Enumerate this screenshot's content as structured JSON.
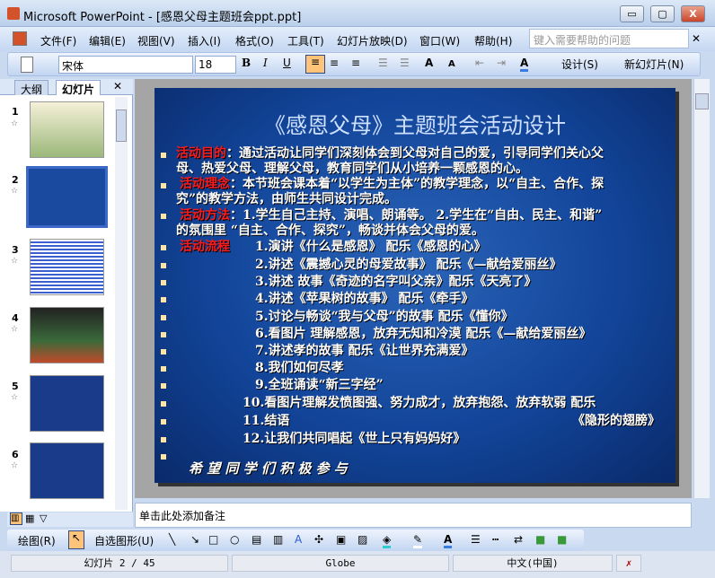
{
  "window": {
    "title": "Microsoft PowerPoint - [感恩父母主题班会ppt.ppt]",
    "min": "▭",
    "max": "▢",
    "close": "X"
  },
  "menu": [
    "文件(F)",
    "编辑(E)",
    "视图(V)",
    "插入(I)",
    "格式(O)",
    "工具(T)",
    "幻灯片放映(D)",
    "窗口(W)",
    "帮助(H)"
  ],
  "help_placeholder": "键入需要帮助的问题",
  "toolbar": {
    "font": "宋体",
    "size": "18",
    "bold": "B",
    "italic": "I",
    "underline": "U",
    "design": "设计(S)",
    "new_slide": "新幻灯片(N)",
    "grow": "A",
    "shrink": "A",
    "font_color": "A"
  },
  "sidebar": {
    "tabs": [
      "大纲",
      "幻灯片"
    ],
    "slides": [
      "1",
      "2",
      "3",
      "4",
      "5",
      "6"
    ],
    "selected": "2"
  },
  "slide": {
    "title": "《感恩父母》主题班会活动设计",
    "p1_label": "活动目的",
    "p1_a": "：通过活动让同学们深刻体会到父母对自己的爱，引导同学们关心父",
    "p1_b": "母、热爱父母、理解父母，教育同学们从小培养一颗感恩的心。",
    "p2_label": "活动理念",
    "p2_a": "：本节班会课本着“以学生为主体”的教学理念，以“自主、合作、探",
    "p2_b": "究”的教学方法，由师生共同设计完成。",
    "p3_label": "活动方法",
    "p3_a": "：1.学生自己主持、演唱、朗诵等。  2.学生在“自由、民主、和谐”",
    "p3_b": "的氛围里 “自主、合作、探究”，畅谈并体会父母的爱。",
    "p4_label": "活动流程",
    "steps": [
      "1.演讲《什么是感恩》 配乐《感恩的心》",
      "2.讲述《震撼心灵的母爱故事》 配乐《—献给爱丽丝》",
      "3.讲述 故事《奇迹的名字叫父亲》配乐《天亮了》",
      "4.讲述《苹果树的故事》  配乐《牵手》",
      "5.讨论与畅谈“我与父母”的故事   配乐《懂你》",
      "6.看图片 理解感恩，放弃无知和冷漠   配乐《—献给爱丽丝》",
      "7.讲述孝的故事   配乐《让世界充满爱》",
      "8.我们如何尽孝",
      "9.全班诵读“新三字经”",
      "10.看图片理解发愤图强、努力成才，放弃抱怨、放弃软弱   配乐",
      "11.结语",
      "12.让我们共同唱起《世上只有妈妈好》"
    ],
    "step11_music": "《隐形的翅膀》",
    "footer": "希 望 同 学 们 积 极 参 与"
  },
  "notes_placeholder": "单击此处添加备注",
  "drawbar": {
    "draw": "绘图(R)",
    "autoshapes": "自选图形(U)"
  },
  "status": {
    "slide": "幻灯片 2 / 45",
    "theme": "Globe",
    "lang": "中文(中国)"
  },
  "colors": {
    "accent_red": "#ff1a1a",
    "slide_blue": "#12459a"
  }
}
